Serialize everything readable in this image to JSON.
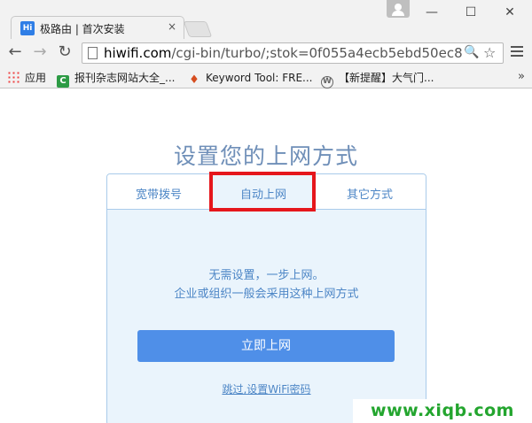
{
  "browser": {
    "tab": {
      "favicon": "Hi",
      "title": "极路由 | 首次安装",
      "close": "×"
    },
    "window_controls": {
      "minimize": "—",
      "maximize": "☐",
      "close": "✕"
    },
    "nav": {
      "back": "←",
      "forward": "→",
      "reload": "↻"
    },
    "url": {
      "host": "hiwifi.com",
      "path": "/cgi-bin/turbo/;stok=0f055a4ecb5ebd50ec8"
    },
    "omnibox_icons": {
      "search": "🔍",
      "star": "☆"
    },
    "bookmarks": [
      {
        "icon": "apps-icon",
        "label": "应用"
      },
      {
        "icon": "c-icon",
        "label": "报刊杂志网站大全_..."
      },
      {
        "icon": "fire-icon",
        "label": "Keyword Tool: FRE..."
      },
      {
        "icon": "wordpress-icon",
        "label": "【新提醒】大气门..."
      }
    ],
    "bookmarks_more": "»"
  },
  "page": {
    "heading": "设置您的上网方式",
    "tabs": [
      {
        "label": "宽带拨号"
      },
      {
        "label": "自动上网"
      },
      {
        "label": "其它方式"
      }
    ],
    "active_tab": "自动上网",
    "message_line1": "无需设置，一步上网。",
    "message_line2": "企业或组织一般会采用这种上网方式",
    "primary_button": "立即上网",
    "skip_link": "跳过,设置WiFi密码"
  },
  "watermark": "www.xiqb.com",
  "colors": {
    "accent": "#4f8fe8",
    "text_blue": "#4d86c6",
    "heading": "#6f8fb8",
    "highlight": "#e5161c",
    "card_bg": "#eaf4fc",
    "watermark": "#23a52e"
  }
}
